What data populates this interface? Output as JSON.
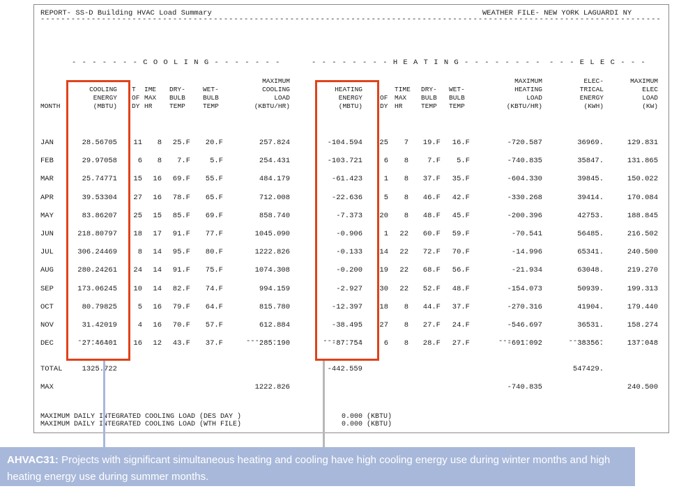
{
  "report_title": "REPORT- SS-D Building HVAC Load Summary",
  "weather_file": "WEATHER FILE- NEW YORK LAGUARDI NY",
  "dash_rule": "----------------------------------------------------------------------------------------------------------------------------------",
  "groups": {
    "cooling": "- - - - - - - C O O L I N G - - - - - - -",
    "heating": "- - - - - - - - H E A T I N G - - - - - - - -",
    "elec": "- - - E L E C - - -"
  },
  "headers": {
    "month": "MONTH",
    "cooling_energy": "COOLING\nENERGY\n(MBTU)",
    "c_time_dy": "T\nOF\nDY",
    "c_time_hr": "IME\nMAX\nHR",
    "c_dry": "DRY-\nBULB\nTEMP",
    "c_wet": "WET-\nBULB\nTEMP",
    "c_max": "MAXIMUM\nCOOLING\nLOAD\n(KBTU/HR)",
    "heating_energy": "HEATING\nENERGY\n(MBTU)",
    "h_time_dy": "\nOF\nDY",
    "h_time_hr": "TIME\nMAX\nHR",
    "h_dry": "DRY-\nBULB\nTEMP",
    "h_wet": "WET-\nBULB\nTEMP",
    "h_max": "MAXIMUM\nHEATING\nLOAD\n(KBTU/HR)",
    "elec_energy": "ELEC-\nTRICAL\nENERGY\n(KWH)",
    "elec_max": "MAXIMUM\nELEC\nLOAD\n(KW)"
  },
  "rows": [
    {
      "month": "JAN",
      "ce": "28.56705",
      "cdy": "11",
      "chr": "8",
      "cdb": "25.F",
      "cwb": "20.F",
      "cmax": "257.824",
      "he": "-104.594",
      "hdy": "25",
      "hhr": "7",
      "hdb": "19.F",
      "hwb": "16.F",
      "hmax": "-720.587",
      "ee": "36969.",
      "em": "129.831"
    },
    {
      "month": "FEB",
      "ce": "29.97058",
      "cdy": "6",
      "chr": "8",
      "cdb": "7.F",
      "cwb": "5.F",
      "cmax": "254.431",
      "he": "-103.721",
      "hdy": "6",
      "hhr": "8",
      "hdb": "7.F",
      "hwb": "5.F",
      "hmax": "-740.835",
      "ee": "35847.",
      "em": "131.865"
    },
    {
      "month": "MAR",
      "ce": "25.74771",
      "cdy": "15",
      "chr": "16",
      "cdb": "69.F",
      "cwb": "55.F",
      "cmax": "484.179",
      "he": "-61.423",
      "hdy": "1",
      "hhr": "8",
      "hdb": "37.F",
      "hwb": "35.F",
      "hmax": "-604.330",
      "ee": "39845.",
      "em": "150.022"
    },
    {
      "month": "APR",
      "ce": "39.53304",
      "cdy": "27",
      "chr": "16",
      "cdb": "78.F",
      "cwb": "65.F",
      "cmax": "712.008",
      "he": "-22.636",
      "hdy": "5",
      "hhr": "8",
      "hdb": "46.F",
      "hwb": "42.F",
      "hmax": "-330.268",
      "ee": "39414.",
      "em": "170.084"
    },
    {
      "month": "MAY",
      "ce": "83.86207",
      "cdy": "25",
      "chr": "15",
      "cdb": "85.F",
      "cwb": "69.F",
      "cmax": "858.740",
      "he": "-7.373",
      "hdy": "20",
      "hhr": "8",
      "hdb": "48.F",
      "hwb": "45.F",
      "hmax": "-200.396",
      "ee": "42753.",
      "em": "188.845"
    },
    {
      "month": "JUN",
      "ce": "218.80797",
      "cdy": "18",
      "chr": "17",
      "cdb": "91.F",
      "cwb": "77.F",
      "cmax": "1045.090",
      "he": "-0.906",
      "hdy": "1",
      "hhr": "22",
      "hdb": "60.F",
      "hwb": "59.F",
      "hmax": "-70.541",
      "ee": "56485.",
      "em": "216.502"
    },
    {
      "month": "JUL",
      "ce": "306.24469",
      "cdy": "8",
      "chr": "14",
      "cdb": "95.F",
      "cwb": "80.F",
      "cmax": "1222.826",
      "he": "-0.133",
      "hdy": "14",
      "hhr": "22",
      "hdb": "72.F",
      "hwb": "70.F",
      "hmax": "-14.996",
      "ee": "65341.",
      "em": "240.500"
    },
    {
      "month": "AUG",
      "ce": "280.24261",
      "cdy": "24",
      "chr": "14",
      "cdb": "91.F",
      "cwb": "75.F",
      "cmax": "1074.308",
      "he": "-0.200",
      "hdy": "19",
      "hhr": "22",
      "hdb": "68.F",
      "hwb": "56.F",
      "hmax": "-21.934",
      "ee": "63048.",
      "em": "219.270"
    },
    {
      "month": "SEP",
      "ce": "173.06245",
      "cdy": "10",
      "chr": "14",
      "cdb": "82.F",
      "cwb": "74.F",
      "cmax": "994.159",
      "he": "-2.927",
      "hdy": "30",
      "hhr": "22",
      "hdb": "52.F",
      "hwb": "48.F",
      "hmax": "-154.073",
      "ee": "50939.",
      "em": "199.313"
    },
    {
      "month": "OCT",
      "ce": "80.79825",
      "cdy": "5",
      "chr": "16",
      "cdb": "79.F",
      "cwb": "64.F",
      "cmax": "815.780",
      "he": "-12.397",
      "hdy": "18",
      "hhr": "8",
      "hdb": "44.F",
      "hwb": "37.F",
      "hmax": "-270.316",
      "ee": "41904.",
      "em": "179.440"
    },
    {
      "month": "NOV",
      "ce": "31.42019",
      "cdy": "4",
      "chr": "16",
      "cdb": "70.F",
      "cwb": "57.F",
      "cmax": "612.884",
      "he": "-38.495",
      "hdy": "27",
      "hhr": "8",
      "hdb": "27.F",
      "hwb": "24.F",
      "hmax": "-546.697",
      "ee": "36531.",
      "em": "158.274"
    },
    {
      "month": "DEC",
      "ce": "27.46401",
      "cdy": "16",
      "chr": "12",
      "cdb": "43.F",
      "cwb": "37.F",
      "cmax": "285.190",
      "he": "-87.754",
      "hdy": "6",
      "hhr": "8",
      "hdb": "28.F",
      "hwb": "27.F",
      "hmax": "-691.092",
      "ee": "38356.",
      "em": "137.048"
    }
  ],
  "subtotal_rules": {
    "ce": "---------",
    "cmax": "----------",
    "he": "---------",
    "hmax": "----------",
    "ee": "--------",
    "em": "-------"
  },
  "total": {
    "label": "TOTAL",
    "ce": "1325.722",
    "he": "-442.559",
    "ee": "547429."
  },
  "max": {
    "label": "MAX",
    "cmax": "1222.826",
    "hmax": "-740.835",
    "em": "240.500"
  },
  "daily": [
    {
      "label": "MAXIMUM DAILY INTEGRATED COOLING LOAD (DES DAY )",
      "value": "0.000",
      "unit": "(KBTU)"
    },
    {
      "label": "MAXIMUM DAILY INTEGRATED COOLING LOAD (WTH FILE)",
      "value": "0.000",
      "unit": "(KBTU)"
    }
  ],
  "note": {
    "code": "AHVAC31:",
    "text": " Projects with significant simultaneous heating and cooling have high cooling energy use during winter months and high heating energy use during summer months."
  },
  "colors": {
    "highlight": "#e0421a",
    "note_bg": "#a8b8da",
    "pointer_blue": "#a8b8da",
    "pointer_gray": "#b8b8b8"
  }
}
